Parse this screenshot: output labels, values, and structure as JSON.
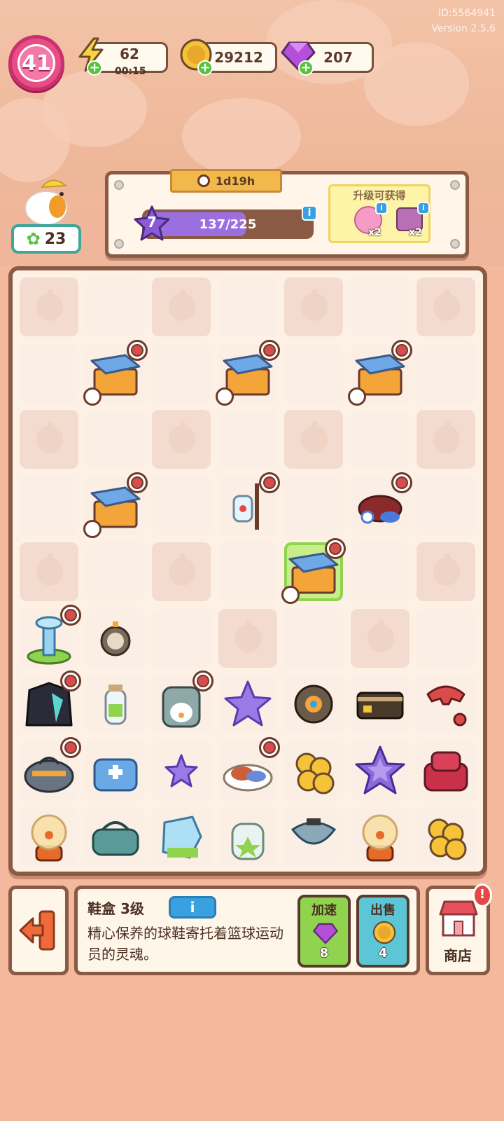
{
  "header": {
    "id_label": "ID:5564941",
    "version_label": "Version 2.5.6"
  },
  "player": {
    "level": "41"
  },
  "resources": {
    "energy": {
      "value": "62",
      "timer": "00:15",
      "icon": "lightning-icon"
    },
    "coins": {
      "value": "29212",
      "icon": "coin-icon"
    },
    "gems": {
      "value": "207",
      "icon": "gem-icon"
    }
  },
  "character": {
    "clover_count": "23"
  },
  "event": {
    "timer": "1d19h",
    "star_level": "7",
    "progress_text": "137/225",
    "progress_fraction": 0.609,
    "rewards_title": "升级可获得",
    "rewards": [
      {
        "icon": "pink-brain-icon",
        "qty": "x2"
      },
      {
        "icon": "go-sign-icon",
        "qty": "x2"
      }
    ]
  },
  "board": {
    "rows": [
      [
        "peach",
        "empty",
        "peach",
        "empty",
        "peach",
        "empty",
        "peach"
      ],
      [
        "empty",
        "shoebox",
        "empty",
        "shoebox",
        "empty",
        "shoebox",
        "empty"
      ],
      [
        "peach",
        "empty",
        "peach",
        "empty",
        "peach",
        "empty",
        "peach"
      ],
      [
        "empty",
        "shoebox",
        "empty",
        "iv-drip",
        "empty",
        "sneakers",
        "empty"
      ],
      [
        "peach",
        "empty",
        "peach",
        "empty",
        "shoebox-selected",
        "empty",
        "peach"
      ],
      [
        "fountain",
        "stopwatch",
        "empty",
        "peach",
        "empty",
        "peach",
        "empty"
      ],
      [
        "jacket",
        "bottle",
        "backpack",
        "star",
        "robot-vacuum",
        "card",
        "phone"
      ],
      [
        "duffel-bag",
        "first-aid-bag",
        "small-star",
        "food-plate",
        "coins",
        "big-star",
        "armchair"
      ],
      [
        "plasma-ball",
        "teal-bag",
        "ice-cube",
        "jar",
        "fanny-pack",
        "plasma-ball",
        "coins"
      ]
    ],
    "clock_cells": [
      "1-1",
      "1-3",
      "1-5",
      "3-1",
      "3-3",
      "3-5",
      "4-4",
      "5-0",
      "6-0",
      "6-2",
      "7-0",
      "7-3"
    ]
  },
  "selected_item": {
    "name": "鞋盒 3级",
    "info_label": "i",
    "description": "精心保养的球鞋寄托着篮球运动员的灵魂。",
    "speedup_label": "加速",
    "speedup_cost": "8",
    "sell_label": "出售",
    "sell_value": "4"
  },
  "shop": {
    "label": "商店",
    "alert": "!"
  },
  "colors": {
    "accent_pink": "#e94d86",
    "panel_border": "#8a5a44",
    "progress_purple": "#9c6fe0",
    "speedup_green": "#8fd34f",
    "sell_teal": "#5cc6d6"
  }
}
